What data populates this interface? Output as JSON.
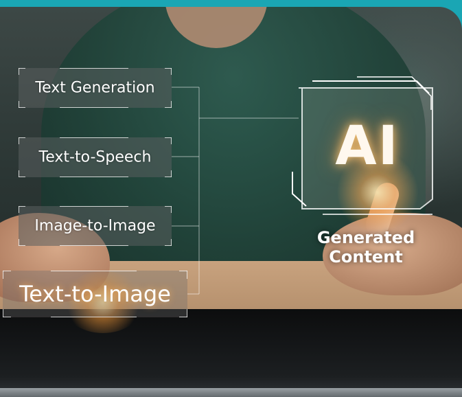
{
  "menu": {
    "items": [
      {
        "label": "Text Generation"
      },
      {
        "label": "Text-to-Speech"
      },
      {
        "label": "Image-to-Image"
      },
      {
        "label": "Text-to-Image"
      }
    ]
  },
  "ai_panel": {
    "logo_text": "AI",
    "caption": "Generated Content"
  },
  "colors": {
    "accent_border": "#1aa6b4",
    "glow": "#ffb060",
    "bracket": "#ffffff"
  },
  "icons": [
    "ai-chip-icon"
  ]
}
